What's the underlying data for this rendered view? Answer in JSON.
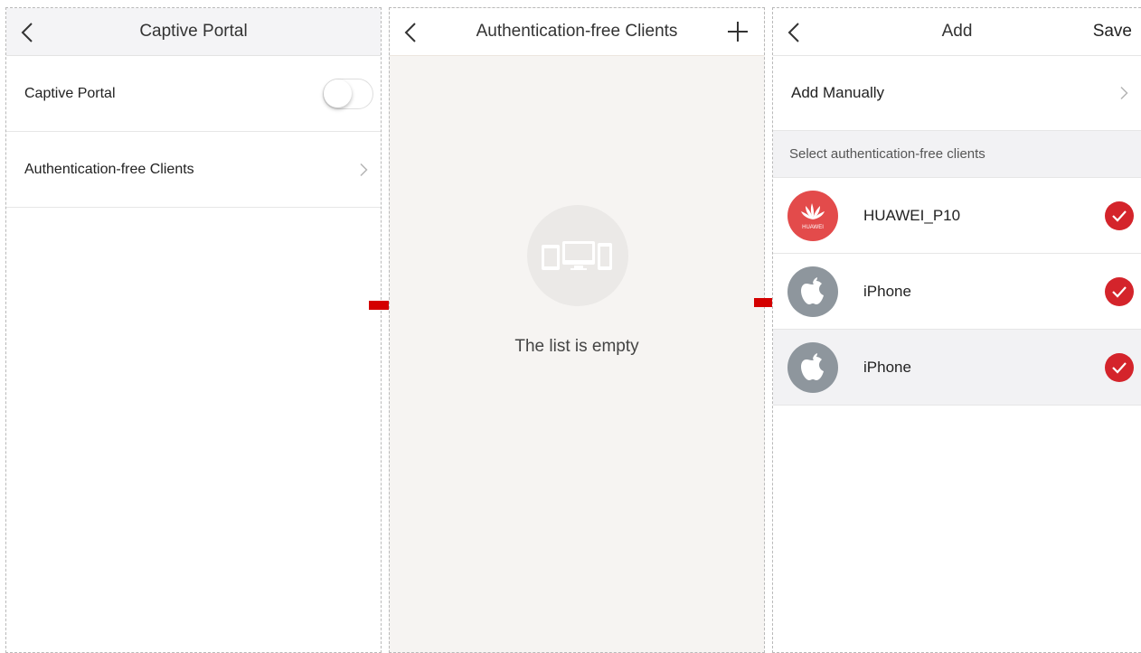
{
  "screen1": {
    "title": "Captive Portal",
    "rows": [
      {
        "label": "Captive Portal",
        "toggle_on": false
      },
      {
        "label": "Authentication-free Clients"
      }
    ]
  },
  "screen2": {
    "title": "Authentication-free Clients",
    "empty_text": "The list is empty"
  },
  "screen3": {
    "title": "Add",
    "save_label": "Save",
    "add_manually_label": "Add Manually",
    "section_label": "Select authentication-free clients",
    "clients": [
      {
        "name": "HUAWEI_P10",
        "icon": "huawei-logo-icon",
        "selected": true
      },
      {
        "name": "iPhone",
        "icon": "apple-logo-icon",
        "selected": true
      },
      {
        "name": "iPhone",
        "icon": "apple-logo-icon",
        "selected": true
      }
    ],
    "huawei_logo_text": "HUAWEI"
  },
  "colors": {
    "accent_red": "#d4242b",
    "huawei_red": "#e34b4b",
    "apple_gray": "#8e969d",
    "arrow_red": "#d40000"
  }
}
